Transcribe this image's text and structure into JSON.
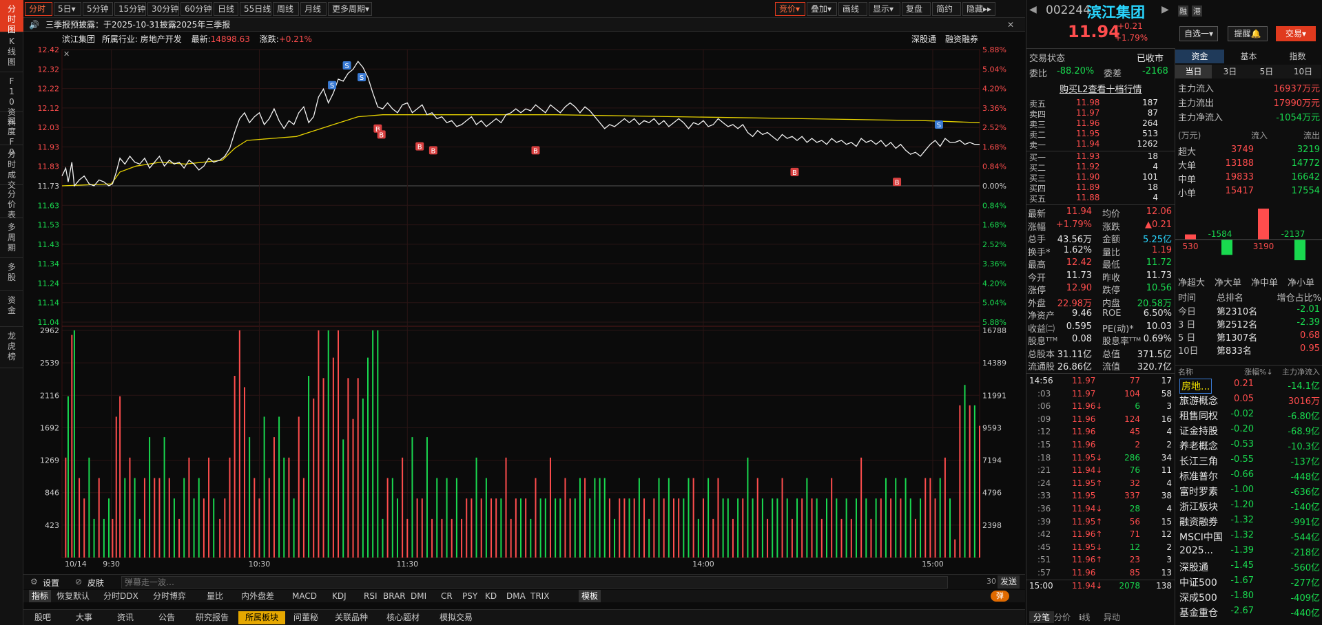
{
  "left_tabs": [
    "分时图",
    "K线图",
    "F10资料",
    "深度F9",
    "分时成交",
    "分价表",
    "多周期",
    "多股",
    "资金",
    "龙虎榜"
  ],
  "toolbar": {
    "items": [
      "分时",
      "5日▾",
      "5分钟",
      "15分钟",
      "30分钟",
      "60分钟",
      "日线",
      "55日线",
      "周线",
      "月线",
      "更多周期▾"
    ],
    "right_items": [
      "竞价▾",
      "叠加▾",
      "画线",
      "显示▾",
      "复盘",
      "简约",
      "隐藏▸▸"
    ]
  },
  "notice": {
    "speaker": "🔊",
    "text": "三季报预披露：于2025-10-31披露2025年三季报",
    "close": "✕"
  },
  "info": {
    "name": "滨江集团",
    "industry_label": "所属行业:",
    "industry": "房地产开发",
    "latest_label": "最新:",
    "latest": "14898.63",
    "change_label": "涨跌:",
    "change": "+0.21%",
    "tag1": "深股通",
    "tag2": "融资融券"
  },
  "chart_data": {
    "type": "line",
    "x_ticks": [
      "10/14",
      "9:30",
      "10:30",
      "11:30",
      "14:00",
      "15:00"
    ],
    "y_price_ticks": [
      "12.42",
      "12.32",
      "12.22",
      "12.12",
      "12.03",
      "11.93",
      "11.83",
      "11.73",
      "11.63",
      "11.53",
      "11.43",
      "11.34",
      "11.24",
      "11.14",
      "11.04"
    ],
    "y_pct_ticks": [
      "5.88%",
      "5.04%",
      "4.20%",
      "3.36%",
      "2.52%",
      "1.68%",
      "0.84%",
      "0.00%",
      "0.84%",
      "1.68%",
      "2.52%",
      "3.36%",
      "4.20%",
      "5.04%",
      "5.88%"
    ],
    "vol_left_ticks": [
      "2962",
      "2539",
      "2116",
      "1692",
      "1269",
      "846",
      "423"
    ],
    "vol_right_ticks": [
      "16788",
      "14389",
      "11991",
      "9593",
      "7194",
      "4796",
      "2398"
    ],
    "prev_close": 11.73,
    "ylim": [
      11.04,
      12.42
    ],
    "price": [
      [
        0,
        11.78
      ],
      [
        3,
        11.82
      ],
      [
        5,
        11.75
      ],
      [
        8,
        11.85
      ],
      [
        10,
        11.73
      ],
      [
        14,
        11.76
      ],
      [
        18,
        11.78
      ],
      [
        22,
        11.74
      ],
      [
        26,
        11.73
      ],
      [
        30,
        11.76
      ],
      [
        34,
        11.75
      ],
      [
        38,
        11.73
      ],
      [
        41,
        11.74
      ],
      [
        44,
        11.8
      ],
      [
        47,
        11.87
      ],
      [
        51,
        11.84
      ],
      [
        55,
        11.88
      ],
      [
        59,
        11.85
      ],
      [
        63,
        11.84
      ],
      [
        67,
        11.87
      ],
      [
        71,
        11.82
      ],
      [
        75,
        11.85
      ],
      [
        79,
        11.88
      ],
      [
        83,
        11.83
      ],
      [
        87,
        11.86
      ],
      [
        91,
        11.84
      ],
      [
        95,
        11.85
      ],
      [
        99,
        11.82
      ],
      [
        103,
        11.86
      ],
      [
        107,
        11.84
      ],
      [
        111,
        11.81
      ],
      [
        115,
        11.83
      ],
      [
        119,
        11.87
      ],
      [
        123,
        11.85
      ],
      [
        128,
        11.86
      ],
      [
        132,
        11.88
      ],
      [
        136,
        11.92
      ],
      [
        140,
        12.0
      ],
      [
        144,
        12.07
      ],
      [
        148,
        12.1
      ],
      [
        152,
        12.05
      ],
      [
        156,
        12.08
      ],
      [
        160,
        12.1
      ],
      [
        164,
        12.04
      ],
      [
        168,
        12.07
      ],
      [
        172,
        12.12
      ],
      [
        176,
        12.06
      ],
      [
        180,
        12.02
      ],
      [
        184,
        12.06
      ],
      [
        188,
        12.04
      ],
      [
        192,
        12.1
      ],
      [
        196,
        12.13
      ],
      [
        200,
        12.05
      ],
      [
        204,
        12.08
      ],
      [
        208,
        12.18
      ],
      [
        212,
        12.22
      ],
      [
        216,
        12.15
      ],
      [
        220,
        12.2
      ],
      [
        224,
        12.27
      ],
      [
        228,
        12.26
      ],
      [
        232,
        12.3
      ],
      [
        236,
        12.32
      ],
      [
        240,
        12.36
      ],
      [
        244,
        12.33
      ],
      [
        248,
        12.28
      ],
      [
        252,
        12.2
      ],
      [
        256,
        12.13
      ],
      [
        260,
        12.12
      ],
      [
        264,
        12.15
      ],
      [
        268,
        12.12
      ],
      [
        272,
        12.1
      ],
      [
        276,
        12.14
      ],
      [
        280,
        12.15
      ],
      [
        284,
        12.1
      ],
      [
        288,
        12.12
      ],
      [
        292,
        12.14
      ],
      [
        296,
        12.09
      ],
      [
        300,
        12.1
      ],
      [
        304,
        12.07
      ],
      [
        308,
        12.08
      ],
      [
        312,
        12.05
      ],
      [
        316,
        12.06
      ],
      [
        320,
        12.03
      ],
      [
        324,
        12.04
      ],
      [
        328,
        12.06
      ],
      [
        332,
        12.08
      ],
      [
        336,
        12.04
      ],
      [
        340,
        12.06
      ],
      [
        344,
        12.03
      ],
      [
        348,
        12.05
      ],
      [
        352,
        12.07
      ],
      [
        356,
        12.05
      ],
      [
        360,
        12.09
      ],
      [
        364,
        12.1
      ],
      [
        368,
        12.12
      ],
      [
        372,
        12.1
      ],
      [
        376,
        12.12
      ],
      [
        380,
        12.11
      ],
      [
        384,
        12.14
      ],
      [
        388,
        12.12
      ],
      [
        392,
        12.1
      ],
      [
        396,
        12.14
      ],
      [
        400,
        12.12
      ],
      [
        404,
        12.1
      ],
      [
        408,
        12.13
      ],
      [
        412,
        12.15
      ],
      [
        416,
        12.13
      ],
      [
        420,
        12.1
      ],
      [
        424,
        12.13
      ],
      [
        428,
        12.11
      ],
      [
        432,
        12.08
      ],
      [
        436,
        12.05
      ],
      [
        440,
        12.02
      ],
      [
        444,
        12.04
      ],
      [
        448,
        12.03
      ],
      [
        452,
        12.05
      ],
      [
        456,
        12.07
      ],
      [
        460,
        12.05
      ],
      [
        464,
        12.07
      ],
      [
        468,
        12.04
      ],
      [
        472,
        12.06
      ],
      [
        476,
        12.05
      ],
      [
        480,
        12.07
      ],
      [
        484,
        12.04
      ],
      [
        488,
        12.06
      ],
      [
        492,
        12.03
      ],
      [
        496,
        12.05
      ],
      [
        500,
        12.07
      ],
      [
        504,
        12.05
      ],
      [
        508,
        12.02
      ],
      [
        512,
        12.05
      ],
      [
        516,
        12.04
      ],
      [
        520,
        12.06
      ],
      [
        524,
        12.03
      ],
      [
        528,
        12.04
      ],
      [
        532,
        12.07
      ],
      [
        536,
        12.05
      ],
      [
        540,
        12.03
      ],
      [
        544,
        12.04
      ],
      [
        548,
        12.02
      ],
      [
        552,
        12.04
      ],
      [
        556,
        12.0
      ],
      [
        560,
        11.98
      ],
      [
        564,
        12.01
      ],
      [
        568,
        11.99
      ],
      [
        572,
        12.0
      ],
      [
        576,
        11.98
      ],
      [
        580,
        11.96
      ],
      [
        584,
        11.99
      ],
      [
        588,
        11.97
      ],
      [
        592,
        11.98
      ],
      [
        596,
        11.96
      ],
      [
        600,
        11.98
      ],
      [
        604,
        11.95
      ],
      [
        608,
        11.97
      ],
      [
        612,
        11.95
      ],
      [
        616,
        11.96
      ],
      [
        620,
        11.94
      ],
      [
        624,
        11.97
      ],
      [
        628,
        11.95
      ],
      [
        632,
        11.96
      ],
      [
        636,
        11.94
      ],
      [
        640,
        11.95
      ],
      [
        644,
        11.93
      ],
      [
        648,
        11.97
      ],
      [
        652,
        11.95
      ],
      [
        656,
        11.96
      ],
      [
        660,
        11.94
      ],
      [
        664,
        11.96
      ],
      [
        668,
        11.93
      ],
      [
        672,
        11.95
      ],
      [
        676,
        11.92
      ],
      [
        680,
        11.94
      ],
      [
        684,
        11.91
      ],
      [
        688,
        11.89
      ],
      [
        692,
        11.9
      ],
      [
        696,
        11.88
      ],
      [
        700,
        11.91
      ],
      [
        704,
        11.94
      ],
      [
        708,
        11.96
      ],
      [
        712,
        11.93
      ],
      [
        716,
        11.97
      ],
      [
        720,
        11.95
      ],
      [
        724,
        11.95
      ],
      [
        728,
        11.96
      ],
      [
        732,
        11.94
      ],
      [
        736,
        11.95
      ],
      [
        740,
        11.94
      ],
      [
        744,
        11.94
      ]
    ],
    "avg": [
      [
        0,
        11.73
      ],
      [
        40,
        11.74
      ],
      [
        47,
        11.8
      ],
      [
        60,
        11.83
      ],
      [
        80,
        11.85
      ],
      [
        100,
        11.84
      ],
      [
        130,
        11.86
      ],
      [
        140,
        11.92
      ],
      [
        150,
        11.96
      ],
      [
        170,
        11.97
      ],
      [
        190,
        11.98
      ],
      [
        200,
        12.0
      ],
      [
        220,
        12.04
      ],
      [
        240,
        12.08
      ],
      [
        260,
        12.09
      ],
      [
        300,
        12.09
      ],
      [
        400,
        12.09
      ],
      [
        500,
        12.08
      ],
      [
        600,
        12.07
      ],
      [
        700,
        12.06
      ],
      [
        744,
        12.05
      ]
    ],
    "markers": [
      {
        "t": 219,
        "side": "S",
        "p": 12.24
      },
      {
        "t": 231,
        "side": "S",
        "p": 12.34
      },
      {
        "t": 243,
        "side": "S",
        "p": 12.28
      },
      {
        "t": 256,
        "side": "B",
        "p": 12.02
      },
      {
        "t": 259,
        "side": "B",
        "p": 11.99
      },
      {
        "t": 290,
        "side": "B",
        "p": 11.93
      },
      {
        "t": 301,
        "side": "B",
        "p": 11.91
      },
      {
        "t": 384,
        "side": "B",
        "p": 11.91
      },
      {
        "t": 594,
        "side": "B",
        "p": 11.8
      },
      {
        "t": 677,
        "side": "B",
        "p": 11.75
      },
      {
        "t": 711,
        "side": "S",
        "p": 12.04
      }
    ]
  },
  "settings": {
    "set": "设置",
    "skin": "皮肤",
    "danmu_placeholder": "弹幕走一波…",
    "count": "30",
    "send": "发送"
  },
  "indicators": {
    "items": [
      "指标",
      "恢复默认",
      "分时DDX",
      "分时博弈",
      "量比",
      "内外盘差",
      "MACD",
      "KDJ",
      "RSI",
      "BRAR",
      "DMI",
      "CR",
      "PSY",
      "KD",
      "DMA",
      "TRIX",
      "模板"
    ],
    "toggle": "弹"
  },
  "bottom_nav": {
    "items": [
      "股吧",
      "大事",
      "资讯",
      "公告",
      "研究报告",
      "所属板块",
      "问董秘",
      "关联品种",
      "核心题材",
      "模拟交易"
    ]
  },
  "quote": {
    "code": "002244",
    "name": "滨江集团",
    "rong": "融",
    "gang": "港",
    "price": "11.94",
    "change": "+0.21",
    "pct": "+1.79%",
    "btn1": "自选一▾",
    "btn2": "提醒🔔",
    "btn3": "交易▾",
    "status_label": "交易状态",
    "status": "已收市",
    "wb_label": "委比",
    "wb": "-88.20%",
    "wc_label": "委差",
    "wc": "-2168",
    "l2": "购买L2查看十档行情",
    "asks": [
      {
        "l": "卖五",
        "p": "11.98",
        "v": "187"
      },
      {
        "l": "卖四",
        "p": "11.97",
        "v": "87"
      },
      {
        "l": "卖三",
        "p": "11.96",
        "v": "264"
      },
      {
        "l": "卖二",
        "p": "11.95",
        "v": "513"
      },
      {
        "l": "卖一",
        "p": "11.94",
        "v": "1262"
      }
    ],
    "bids": [
      {
        "l": "买一",
        "p": "11.93",
        "v": "18"
      },
      {
        "l": "买二",
        "p": "11.92",
        "v": "4"
      },
      {
        "l": "买三",
        "p": "11.90",
        "v": "101"
      },
      {
        "l": "买四",
        "p": "11.89",
        "v": "18"
      },
      {
        "l": "买五",
        "p": "11.88",
        "v": "4"
      }
    ],
    "stats": [
      [
        "最新",
        "11.94",
        "均价",
        "12.06"
      ],
      [
        "涨幅",
        "+1.79%",
        "涨跌",
        "▲0.21"
      ],
      [
        "总手",
        "43.56万",
        "金额",
        "5.25亿"
      ],
      [
        "换手*",
        "1.62%",
        "量比",
        "1.19"
      ],
      [
        "最高",
        "12.42",
        "最低",
        "11.72"
      ],
      [
        "今开",
        "11.73",
        "昨收",
        "11.73"
      ],
      [
        "涨停",
        "12.90",
        "跌停",
        "10.56"
      ],
      [
        "外盘",
        "22.98万",
        "内盘",
        "20.58万"
      ],
      [
        "净资产",
        "9.46",
        "ROE",
        "6.50%"
      ],
      [
        "收益㈡",
        "0.595",
        "PE(动)*",
        "10.03"
      ],
      [
        "股息ᵀᵀᴹ",
        "0.08",
        "股息率ᵀᵀᴹ",
        "0.69%"
      ],
      [
        "总股本",
        "31.11亿",
        "总值",
        "371.5亿"
      ],
      [
        "流通股",
        "26.86亿",
        "流值",
        "320.7亿"
      ]
    ],
    "trades": [
      [
        "14:56",
        "11.97",
        "77",
        "17"
      ],
      [
        ":03",
        "11.97",
        "104",
        "58"
      ],
      [
        ":06",
        "11.96↓",
        "6",
        "3"
      ],
      [
        ":09",
        "11.96",
        "124",
        "16"
      ],
      [
        ":12",
        "11.96",
        "45",
        "4"
      ],
      [
        ":15",
        "11.96",
        "2",
        "2"
      ],
      [
        ":18",
        "11.95↓",
        "286",
        "34"
      ],
      [
        ":21",
        "11.94↓",
        "76",
        "11"
      ],
      [
        ":24",
        "11.95↑",
        "32",
        "4"
      ],
      [
        ":33",
        "11.95",
        "337",
        "38"
      ],
      [
        ":36",
        "11.94↓",
        "28",
        "4"
      ],
      [
        ":39",
        "11.95↑",
        "56",
        "15"
      ],
      [
        ":42",
        "11.96↑",
        "71",
        "12"
      ],
      [
        ":45",
        "11.95↓",
        "12",
        "2"
      ],
      [
        ":51",
        "11.96↑",
        "23",
        "3"
      ],
      [
        ":57",
        "11.96",
        "85",
        "13"
      ],
      [
        "15:00",
        "11.94↓",
        "2078",
        "138"
      ]
    ],
    "trade_tabs": [
      "分笔",
      "分价",
      "ℹ线",
      "异动"
    ]
  },
  "funds": {
    "tabs": [
      "资金",
      "基本",
      "指数"
    ],
    "periods": [
      "当日",
      "3日",
      "5日",
      "10日"
    ],
    "main_in_label": "主力流入",
    "main_in": "16937万元",
    "main_out_label": "主力流出",
    "main_out": "17990万元",
    "main_net_label": "主力净流入",
    "main_net": "-1054万元",
    "unit": "(万元)",
    "in_hdr": "流入",
    "out_hdr": "流出",
    "rows": [
      [
        "超大",
        "3749",
        "3219"
      ],
      [
        "大单",
        "13188",
        "14772"
      ],
      [
        "中单",
        "19833",
        "16642"
      ],
      [
        "小单",
        "15417",
        "17554"
      ]
    ],
    "net_values": [
      530,
      -1584,
      3190,
      -2137
    ],
    "net_labels": [
      "净超大",
      "净大单",
      "净中单",
      "净小单"
    ],
    "rank_hdr": [
      "时间",
      "总排名",
      "增仓占比%"
    ],
    "ranks": [
      [
        "今日",
        "第2310名",
        "-2.01"
      ],
      [
        "3 日",
        "第2512名",
        "-2.39"
      ],
      [
        "5 日",
        "第1307名",
        "0.68"
      ],
      [
        "10日",
        "第833名",
        "0.95"
      ]
    ],
    "sector_hdr": [
      "名称",
      "涨幅%↓",
      "主力净流入"
    ],
    "sectors": [
      [
        "房地...",
        "0.21",
        "-14.1亿"
      ],
      [
        "旅游概念",
        "0.05",
        "3016万"
      ],
      [
        "租售同权",
        "-0.02",
        "-6.80亿"
      ],
      [
        "证金持股",
        "-0.20",
        "-68.9亿"
      ],
      [
        "养老概念",
        "-0.53",
        "-10.3亿"
      ],
      [
        "长江三角",
        "-0.55",
        "-137亿"
      ],
      [
        "标准普尔",
        "-0.66",
        "-448亿"
      ],
      [
        "富时罗素",
        "-1.00",
        "-636亿"
      ],
      [
        "浙江板块",
        "-1.20",
        "-140亿"
      ],
      [
        "融资融券",
        "-1.32",
        "-991亿"
      ],
      [
        "MSCI中国",
        "-1.32",
        "-544亿"
      ],
      [
        "2025...",
        "-1.39",
        "-218亿"
      ],
      [
        "深股通",
        "-1.45",
        "-560亿"
      ],
      [
        "中证500",
        "-1.67",
        "-277亿"
      ],
      [
        "深成500",
        "-1.80",
        "-409亿"
      ],
      [
        "基金重仓",
        "-2.67",
        "-440亿"
      ]
    ]
  }
}
